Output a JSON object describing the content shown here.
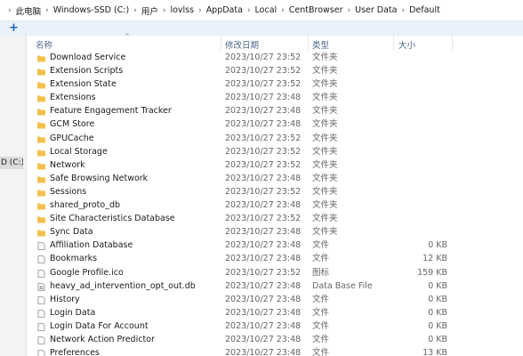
{
  "breadcrumb": [
    "此电脑",
    "Windows-SSD (C:)",
    "用户",
    "lovlss",
    "AppData",
    "Local",
    "CentBrowser",
    "User Data",
    "Default"
  ],
  "breadcrumb_separator": "›",
  "toolbar": {
    "add_label": "+"
  },
  "left_pane": {
    "drive_label": "D (C:)"
  },
  "columns": {
    "name": "名称",
    "date": "修改日期",
    "type": "类型",
    "size": "大小"
  },
  "sort_indicator": "^",
  "colors": {
    "folder": "#f3c14b",
    "header_text": "#4d6a8a",
    "toolbar_bg": "#e9f1fb"
  },
  "rows": [
    {
      "name": "Download Service",
      "date": "2023/10/27 23:52",
      "type": "文件夹",
      "size": "",
      "icon": "folder-icon"
    },
    {
      "name": "Extension Scripts",
      "date": "2023/10/27 23:52",
      "type": "文件夹",
      "size": "",
      "icon": "folder-icon"
    },
    {
      "name": "Extension State",
      "date": "2023/10/27 23:52",
      "type": "文件夹",
      "size": "",
      "icon": "folder-icon"
    },
    {
      "name": "Extensions",
      "date": "2023/10/27 23:48",
      "type": "文件夹",
      "size": "",
      "icon": "folder-icon"
    },
    {
      "name": "Feature Engagement Tracker",
      "date": "2023/10/27 23:48",
      "type": "文件夹",
      "size": "",
      "icon": "folder-icon"
    },
    {
      "name": "GCM Store",
      "date": "2023/10/27 23:48",
      "type": "文件夹",
      "size": "",
      "icon": "folder-icon"
    },
    {
      "name": "GPUCache",
      "date": "2023/10/27 23:52",
      "type": "文件夹",
      "size": "",
      "icon": "folder-icon"
    },
    {
      "name": "Local Storage",
      "date": "2023/10/27 23:52",
      "type": "文件夹",
      "size": "",
      "icon": "folder-icon"
    },
    {
      "name": "Network",
      "date": "2023/10/27 23:52",
      "type": "文件夹",
      "size": "",
      "icon": "folder-icon"
    },
    {
      "name": "Safe Browsing Network",
      "date": "2023/10/27 23:48",
      "type": "文件夹",
      "size": "",
      "icon": "folder-icon"
    },
    {
      "name": "Sessions",
      "date": "2023/10/27 23:52",
      "type": "文件夹",
      "size": "",
      "icon": "folder-icon"
    },
    {
      "name": "shared_proto_db",
      "date": "2023/10/27 23:48",
      "type": "文件夹",
      "size": "",
      "icon": "folder-icon"
    },
    {
      "name": "Site Characteristics Database",
      "date": "2023/10/27 23:52",
      "type": "文件夹",
      "size": "",
      "icon": "folder-icon"
    },
    {
      "name": "Sync Data",
      "date": "2023/10/27 23:48",
      "type": "文件夹",
      "size": "",
      "icon": "folder-icon"
    },
    {
      "name": "Affiliation Database",
      "date": "2023/10/27 23:48",
      "type": "文件",
      "size": "0 KB",
      "icon": "file-icon"
    },
    {
      "name": "Bookmarks",
      "date": "2023/10/27 23:48",
      "type": "文件",
      "size": "12 KB",
      "icon": "file-icon"
    },
    {
      "name": "Google Profile.ico",
      "date": "2023/10/27 23:52",
      "type": "图标",
      "size": "159 KB",
      "icon": "file-icon"
    },
    {
      "name": "heavy_ad_intervention_opt_out.db",
      "date": "2023/10/27 23:48",
      "type": "Data Base File",
      "size": "0 KB",
      "icon": "db-file-icon"
    },
    {
      "name": "History",
      "date": "2023/10/27 23:48",
      "type": "文件",
      "size": "0 KB",
      "icon": "file-icon"
    },
    {
      "name": "Login Data",
      "date": "2023/10/27 23:48",
      "type": "文件",
      "size": "0 KB",
      "icon": "file-icon"
    },
    {
      "name": "Login Data For Account",
      "date": "2023/10/27 23:48",
      "type": "文件",
      "size": "0 KB",
      "icon": "file-icon"
    },
    {
      "name": "Network Action Predictor",
      "date": "2023/10/27 23:48",
      "type": "文件",
      "size": "0 KB",
      "icon": "file-icon"
    },
    {
      "name": "Preferences",
      "date": "2023/10/27 23:48",
      "type": "文件",
      "size": "13 KB",
      "icon": "file-icon"
    }
  ]
}
